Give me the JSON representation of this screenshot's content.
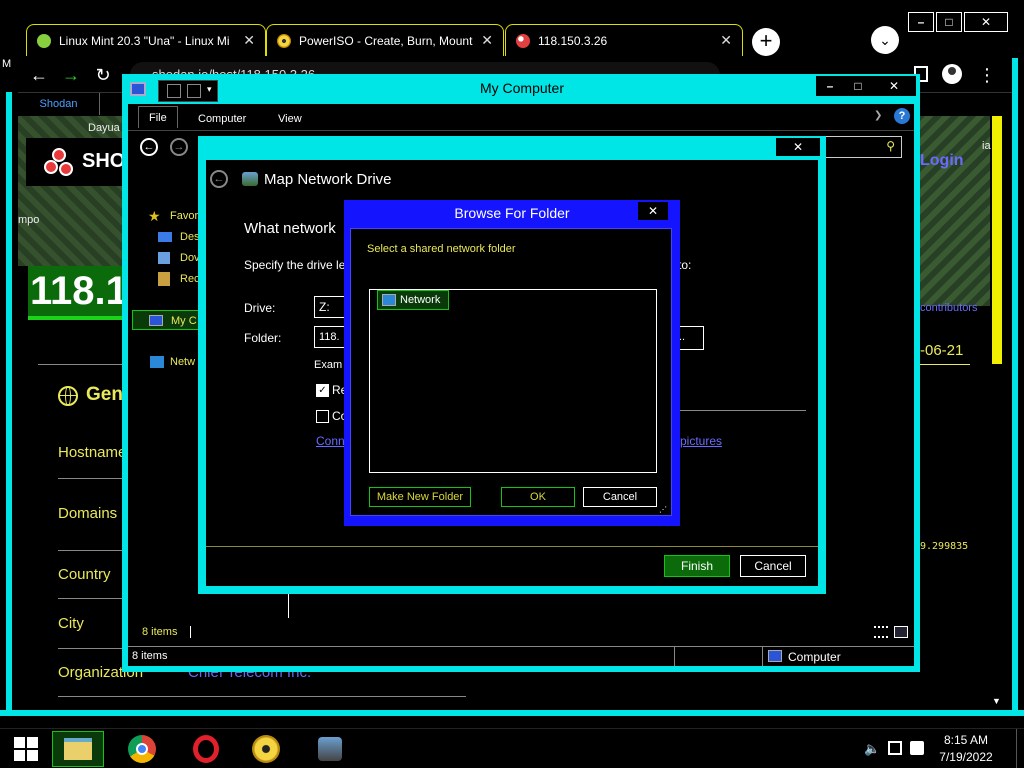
{
  "browser": {
    "tabs": [
      {
        "title": "Linux Mint 20.3 \"Una\" - Linux Mi",
        "close": "✕"
      },
      {
        "title": "PowerISO - Create, Burn, Mount,",
        "close": "✕"
      },
      {
        "title": "118.150.3.26",
        "close": "✕"
      }
    ],
    "new_tab": "+",
    "tab_search": "⌄",
    "win_controls": {
      "minimize": "–",
      "maximize": "□",
      "close": "✕"
    },
    "url": "shodan.io/host/118.150.3.26",
    "left_edge_glyph": "M",
    "bookmark": "Shodan",
    "nav": {
      "back": "←",
      "forward": "→",
      "reload": "↻",
      "menu": "⋮"
    }
  },
  "shodan": {
    "logo_text": "SHO",
    "map_labels": {
      "dayua": "Dayua",
      "a": "a",
      "mpo": "mpo",
      "ia": "ia"
    },
    "login": "Login",
    "contributors": "contributors",
    "ip_fragment": "118.1",
    "date_fragment": "-06-21",
    "coord_fragment": "9.299835",
    "section_title": "Gen",
    "fields": [
      "Hostname",
      "Domains",
      "Country",
      "City",
      "Organization"
    ],
    "org_value": "Chief Telecom Inc."
  },
  "mycomputer": {
    "title": "My Computer",
    "controls": {
      "minimize": "–",
      "maximize": "□",
      "close": "✕"
    },
    "ribbon_tabs": [
      "File",
      "Computer",
      "View"
    ],
    "help": "?",
    "nav_items": [
      "Favori",
      "Des",
      "Dov",
      "Rec",
      "My C",
      "Netw"
    ],
    "status_items": "8 items",
    "status_items_bar": "8 items",
    "status_location": "Computer"
  },
  "mapdrive": {
    "close": "✕",
    "title": "Map Network Drive",
    "heading": "What network",
    "instructions": "Specify the drive let",
    "instructions_tail": "to:",
    "drive_label": "Drive:",
    "drive_value": "Z:",
    "folder_label": "Folder:",
    "folder_value": "118.",
    "browse_label": "..",
    "example": "Exam",
    "reconnect": "Re",
    "connect_other": "Co",
    "link_start": "Conn",
    "link_end": "pictures",
    "finish": "Finish",
    "cancel": "Cancel"
  },
  "browse": {
    "title": "Browse For Folder",
    "close": "✕",
    "prompt": "Select a shared network folder",
    "tree_item": "Network",
    "make_new_folder": "Make New Folder",
    "ok": "OK",
    "cancel": "Cancel"
  },
  "taskbar": {
    "time": "8:15 AM",
    "date": "7/19/2022"
  }
}
